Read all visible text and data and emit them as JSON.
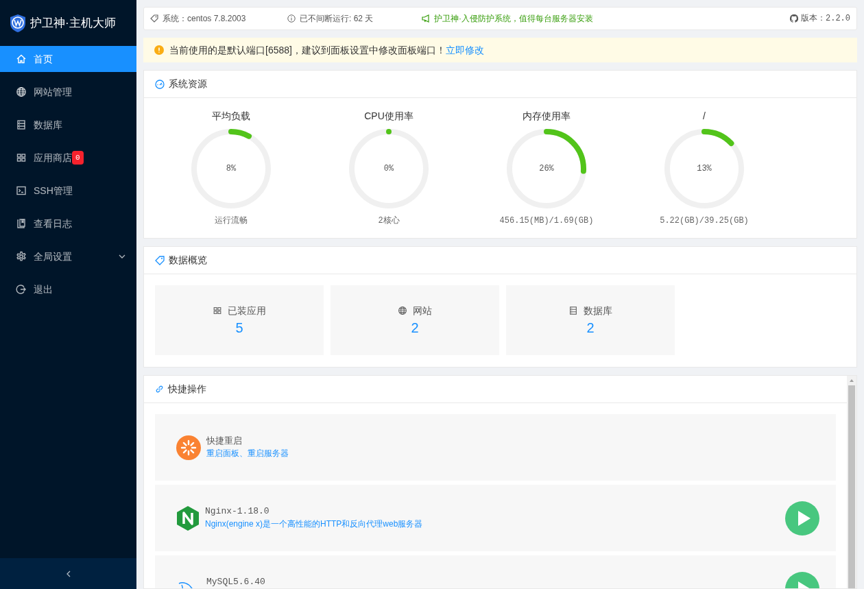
{
  "sidebar": {
    "brand": "护卫神·主机大师",
    "items": [
      {
        "label": "首页",
        "selected": true
      },
      {
        "label": "网站管理",
        "selected": false
      },
      {
        "label": "数据库",
        "selected": false
      },
      {
        "label": "应用商店",
        "selected": false,
        "badge": "0"
      },
      {
        "label": "SSH管理",
        "selected": false
      },
      {
        "label": "查看日志",
        "selected": false
      },
      {
        "label": "全局设置",
        "selected": false,
        "expanded": false
      },
      {
        "label": "退出",
        "selected": false
      }
    ]
  },
  "top_bar": {
    "system": "系统：centos 7.8.2003",
    "uptime": "已不间断运行: 62 天",
    "promo": "护卫神·入侵防护系统，值得每台服务器安装",
    "version": "版本：2.2.0"
  },
  "alert": {
    "text": "当前使用的是默认端口[6588]，建议到面板设置中修改面板端口！",
    "link": "立即修改"
  },
  "resources": {
    "title": "系统资源",
    "gauges": [
      {
        "label": "平均负载",
        "value": "8%",
        "level": 0.08,
        "detail": "运行流畅"
      },
      {
        "label": "CPU使用率",
        "value": "0%",
        "level": 0,
        "detail": "2核心"
      },
      {
        "label": "内存使用率",
        "value": "26%",
        "level": 0.26,
        "detail": "456.15(MB)/1.69(GB)"
      },
      {
        "label": "/",
        "value": "13%",
        "level": 0.13,
        "detail": "5.22(GB)/39.25(GB)"
      }
    ]
  },
  "overview": {
    "title": "数据概览",
    "cards": [
      {
        "kind": "apps",
        "label": "已装应用",
        "value": "5"
      },
      {
        "kind": "sites",
        "label": "网站",
        "value": "2"
      },
      {
        "kind": "databases",
        "label": "数据库",
        "value": "2"
      }
    ]
  },
  "quick": {
    "title": "快捷操作",
    "items": [
      {
        "kind": "restart",
        "name": "快捷重启",
        "description": "重启面板、重启服务器"
      },
      {
        "kind": "nginx",
        "name": "Nginx-1.18.0",
        "description": "Nginx(engine x)是一个高性能的HTTP和反向代理web服务器"
      },
      {
        "kind": "mysql",
        "name": "MySQL5.6.40"
      }
    ]
  }
}
